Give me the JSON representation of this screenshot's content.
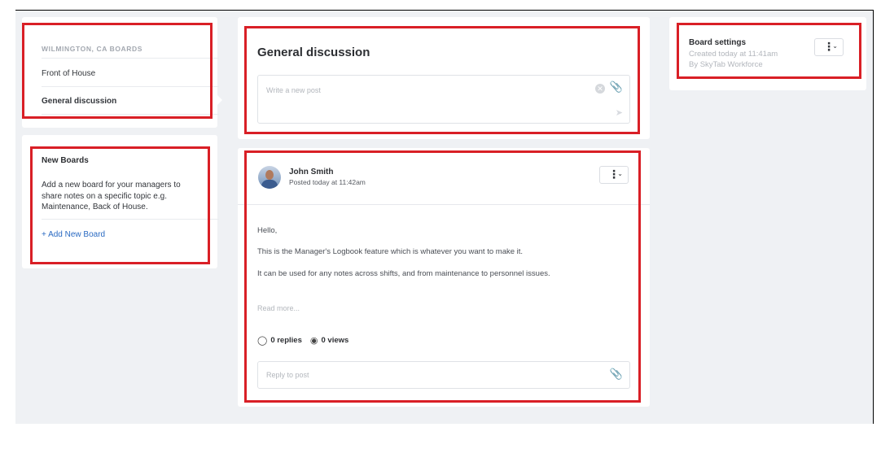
{
  "sidebar": {
    "heading": "WILMINGTON, CA BOARDS",
    "items": [
      {
        "label": "Front of House",
        "active": false
      },
      {
        "label": "General discussion",
        "active": true
      }
    ]
  },
  "new_boards": {
    "title": "New Boards",
    "description": "Add a new board for your managers to share notes on a specific topic e.g. Maintenance, Back of House.",
    "add_label": "+ Add New Board"
  },
  "compose": {
    "title": "General discussion",
    "placeholder": "Write a new post"
  },
  "post": {
    "author": "John Smith",
    "posted": "Posted today at 11:42am",
    "body": [
      "Hello,",
      "This is the Manager's Logbook feature which is whatever you want to make it.",
      "It can be used for any notes across shifts, and from maintenance to personnel issues."
    ],
    "read_more": "Read more...",
    "replies": "0 replies",
    "views": "0 views",
    "reply_placeholder": "Reply to post"
  },
  "settings": {
    "title": "Board settings",
    "created": "Created today at 11:41am",
    "by": "By SkyTab Workforce"
  },
  "icons": {
    "menu": "vertical-dots-icon",
    "chevron": "chevron-down-icon",
    "attach": "paperclip-icon",
    "clear": "clear-circle-icon",
    "send": "send-icon",
    "replies": "comment-icon",
    "views": "eye-icon"
  },
  "colors": {
    "highlight": "#d91f26",
    "link": "#2a6ac2",
    "background": "#eff1f4"
  }
}
